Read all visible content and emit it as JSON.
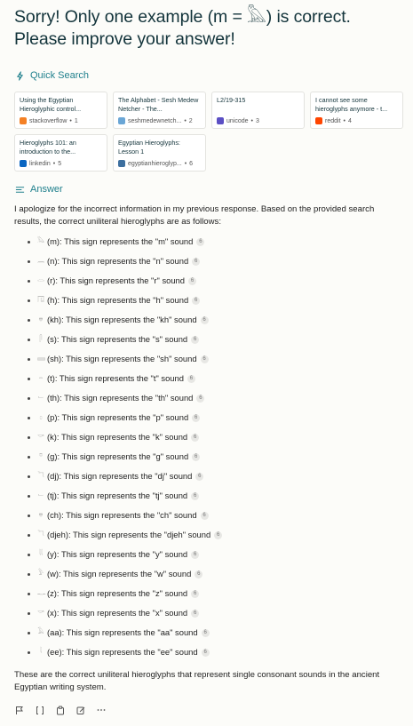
{
  "question": "Sorry! Only one example (m = 𓅓) is correct. Please improve your answer!",
  "quick_search": {
    "label": "Quick Search",
    "sources": [
      {
        "title": "Using the Egyptian Hieroglyphic control...",
        "site": "stackoverflow",
        "num": "1",
        "color": "#f48024"
      },
      {
        "title": "The Alphabet - Sesh Medew Netcher - The...",
        "site": "seshmedewnetch...",
        "num": "2",
        "color": "#6aa6d6"
      },
      {
        "title": "L2/19-315",
        "site": "unicode",
        "num": "3",
        "color": "#5b4fc4"
      },
      {
        "title": "I cannot see some hieroglyphs anymore - t...",
        "site": "reddit",
        "num": "4",
        "color": "#ff4500"
      },
      {
        "title": "Hieroglyphs 101: an introduction to the...",
        "site": "linkedin",
        "num": "5",
        "color": "#0a66c2"
      },
      {
        "title": "Egyptian Hieroglyphs: Lesson 1",
        "site": "egyptianhieroglyp...",
        "num": "6",
        "color": "#3d6f9f"
      }
    ]
  },
  "answer": {
    "label": "Answer",
    "intro": "I apologize for the incorrect information in my previous response. Based on the provided search results, the correct uniliteral hieroglyphs are as follows:",
    "items": [
      {
        "glyph": "𓅓",
        "text": "(m): This sign represents the \"m\" sound",
        "cite": "6"
      },
      {
        "glyph": "𓈖",
        "text": "(n): This sign represents the \"n\" sound",
        "cite": "6"
      },
      {
        "glyph": "𓂋",
        "text": "(r): This sign represents the \"r\" sound",
        "cite": "6"
      },
      {
        "glyph": "𓉔",
        "text": "(h): This sign represents the \"h\" sound",
        "cite": "6"
      },
      {
        "glyph": "𓐍",
        "text": "(kh): This sign represents the \"kh\" sound",
        "cite": "6"
      },
      {
        "glyph": "𓋴",
        "text": "(s): This sign represents the \"s\" sound",
        "cite": "6"
      },
      {
        "glyph": "𓈙",
        "text": "(sh): This sign represents the \"sh\" sound",
        "cite": "6"
      },
      {
        "glyph": "𓏏",
        "text": "(t): This sign represents the \"t\" sound",
        "cite": "6"
      },
      {
        "glyph": "𓍿",
        "text": "(th): This sign represents the \"th\" sound",
        "cite": "6"
      },
      {
        "glyph": "𓊪",
        "text": "(p): This sign represents the \"p\" sound",
        "cite": "6"
      },
      {
        "glyph": "𓎡",
        "text": "(k): This sign represents the \"k\" sound",
        "cite": "6"
      },
      {
        "glyph": "𓎼",
        "text": "(g): This sign represents the \"g\" sound",
        "cite": "6"
      },
      {
        "glyph": "𓆓",
        "text": "(dj): This sign represents the \"dj\" sound",
        "cite": "6"
      },
      {
        "glyph": "𓍿",
        "text": "(tj): This sign represents the \"tj\" sound",
        "cite": "6"
      },
      {
        "glyph": "𓐍",
        "text": "(ch): This sign represents the \"ch\" sound",
        "cite": "6"
      },
      {
        "glyph": "𓆓",
        "text": "(djeh): This sign represents the \"djeh\" sound",
        "cite": "6"
      },
      {
        "glyph": "𓇌",
        "text": "(y): This sign represents the \"y\" sound",
        "cite": "6"
      },
      {
        "glyph": "𓅱",
        "text": "(w): This sign represents the \"w\" sound",
        "cite": "6"
      },
      {
        "glyph": "𓊃",
        "text": "(z): This sign represents the \"z\" sound",
        "cite": "6"
      },
      {
        "glyph": "𓎡",
        "text": "(x): This sign represents the \"x\" sound",
        "cite": "6"
      },
      {
        "glyph": "𓄿",
        "text": "(aa): This sign represents the \"aa\" sound",
        "cite": "6"
      },
      {
        "glyph": "𓇋",
        "text": "(ee): This sign represents the \"ee\" sound",
        "cite": "6"
      }
    ],
    "outro": "These are the correct uniliteral hieroglyphs that represent single consonant sounds in the ancient Egyptian writing system."
  },
  "icons": {
    "quick_search": "quick-search-icon",
    "answer": "answer-icon",
    "toolbar": [
      "flag-icon",
      "brackets-icon",
      "copy-icon",
      "edit-icon",
      "more-icon"
    ]
  },
  "colors": {
    "accent": "#20808d",
    "text": "#13343b",
    "background": "#fcfcf9"
  }
}
